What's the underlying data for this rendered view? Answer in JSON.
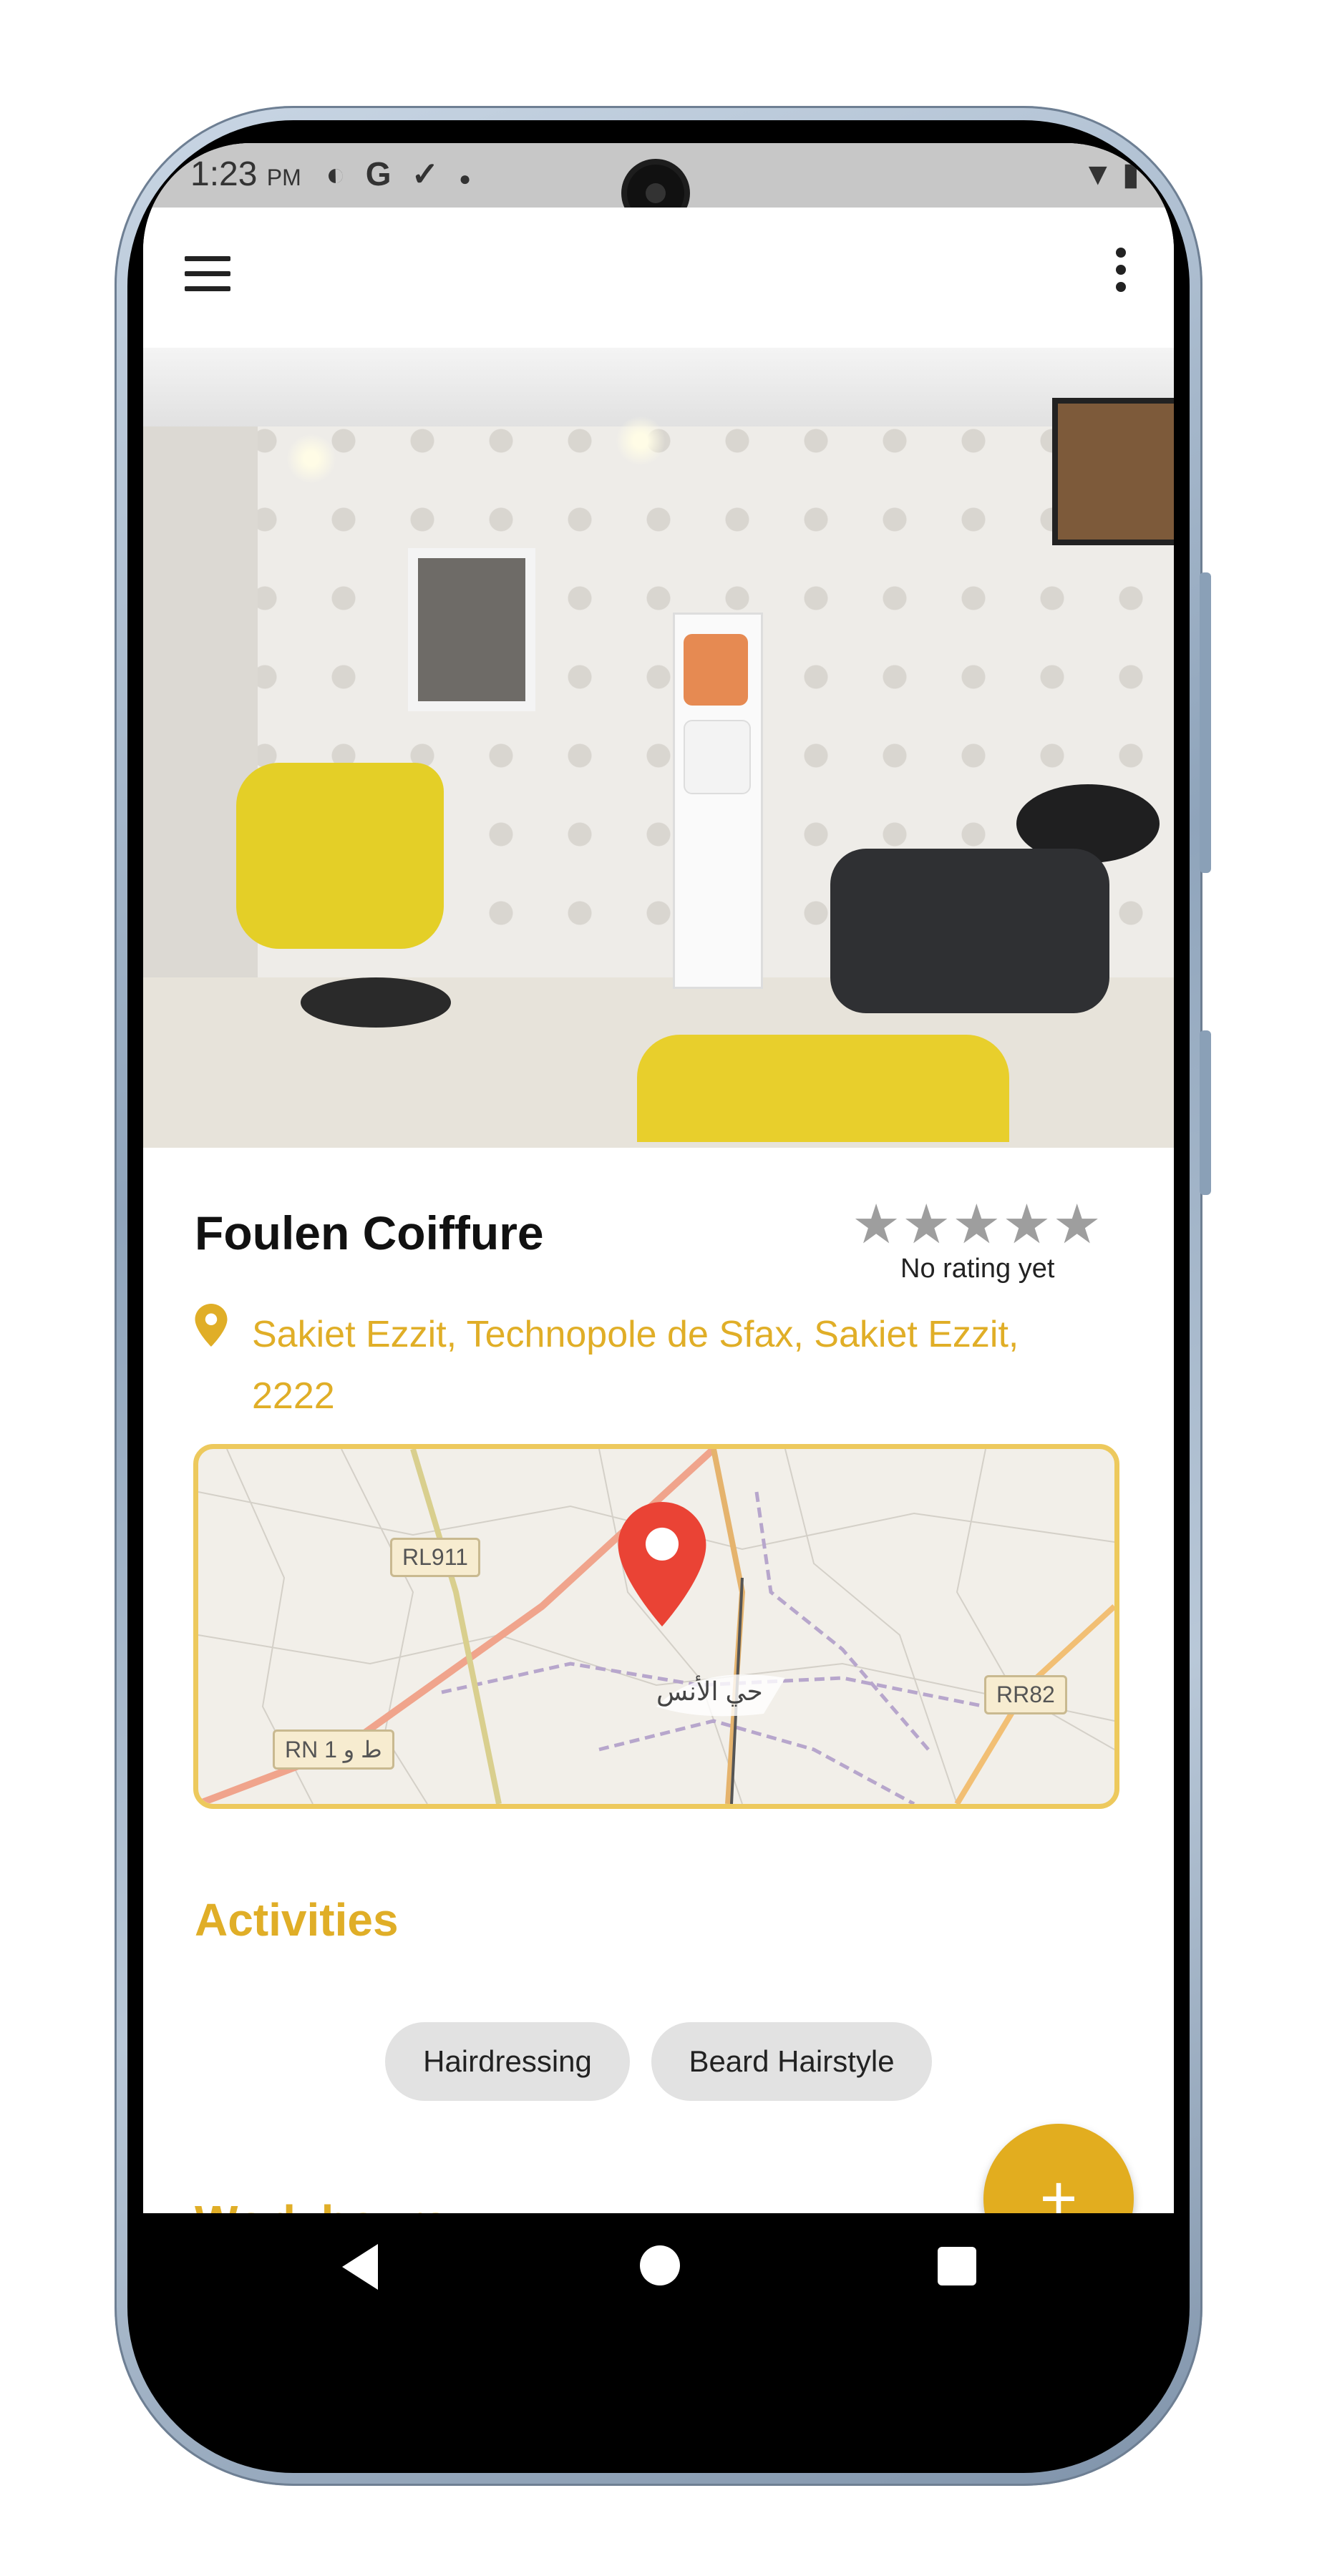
{
  "status_bar": {
    "time": "1:23",
    "ampm": "PM",
    "left_icons": [
      "data-saver-icon",
      "google-icon",
      "download-done-icon",
      "dot-icon"
    ],
    "right_icons": [
      "wifi-icon",
      "battery-charging-icon"
    ]
  },
  "app_bar": {
    "menu_icon": "hamburger-menu-icon",
    "overflow_icon": "more-vert-icon"
  },
  "salon": {
    "name": "Foulen Coiffure",
    "rating_stars": 5,
    "rating_value": 0,
    "rating_text": "No rating yet",
    "address": "Sakiet Ezzit, Technopole de Sfax, Sakiet Ezzit, 2222"
  },
  "map": {
    "road_labels": [
      "RL911",
      "RR82",
      "RN 1 ط و"
    ],
    "area_label": "حي الأنس",
    "marker_icon": "map-pin-icon"
  },
  "activities": {
    "title": "Activities",
    "chips": [
      "Hairdressing",
      "Beard Hairstyle"
    ]
  },
  "work_hours": {
    "title": "Work hours"
  },
  "fab": {
    "label": "+"
  },
  "colors": {
    "accent": "#E0AE27",
    "fab": "#E2AD1F",
    "chip_bg": "#E2E2E2",
    "map_border": "#EDC95D",
    "star_empty": "#9E9E9E"
  }
}
